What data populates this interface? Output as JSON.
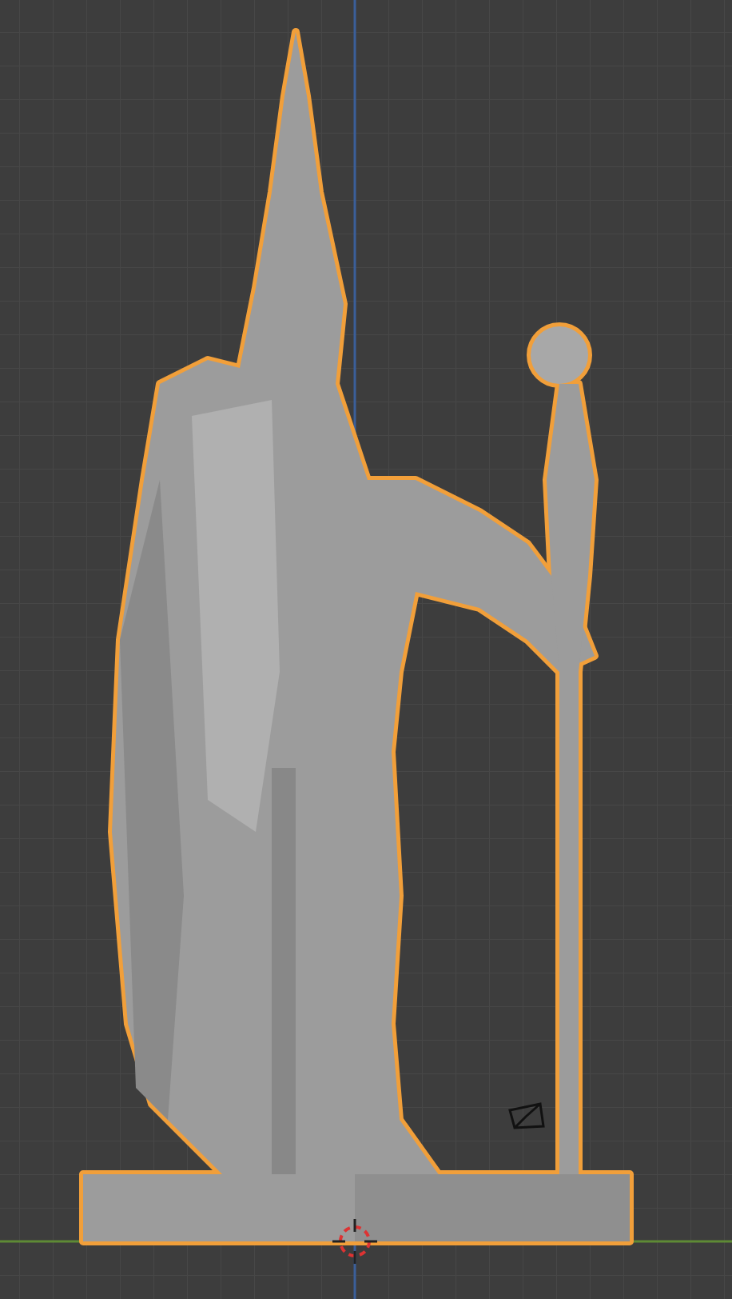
{
  "viewport": {
    "selected": true
  }
}
